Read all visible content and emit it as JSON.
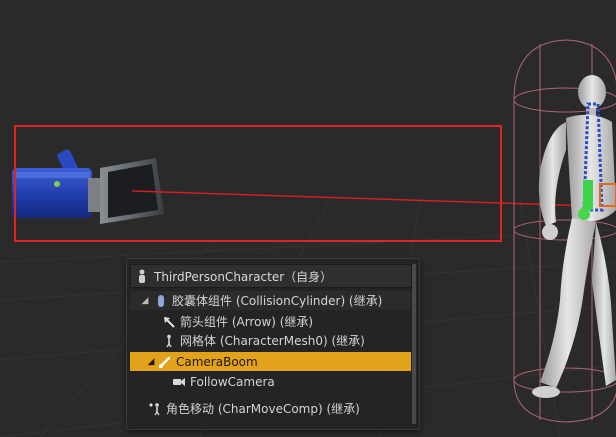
{
  "viewport": {
    "background": "#2a2a2a",
    "grid_color": "#333333",
    "highlight_color": "#e02424"
  },
  "components": {
    "root": "ThirdPersonCharacter（自身）",
    "items": [
      {
        "label": "胶囊体组件 (CollisionCylinder) (继承)",
        "icon": "capsule-icon"
      },
      {
        "label": "箭头组件 (Arrow) (继承)",
        "icon": "arrow-component-icon"
      },
      {
        "label": "网格体 (CharacterMesh0) (继承)",
        "icon": "skeletal-mesh-icon"
      },
      {
        "label": "CameraBoom",
        "icon": "spring-arm-icon",
        "selected": true
      },
      {
        "label": "FollowCamera",
        "icon": "camera-icon"
      },
      {
        "label": "角色移动 (CharMoveComp) (继承)",
        "icon": "movement-icon"
      }
    ],
    "selected_color": "#e2a31a"
  }
}
